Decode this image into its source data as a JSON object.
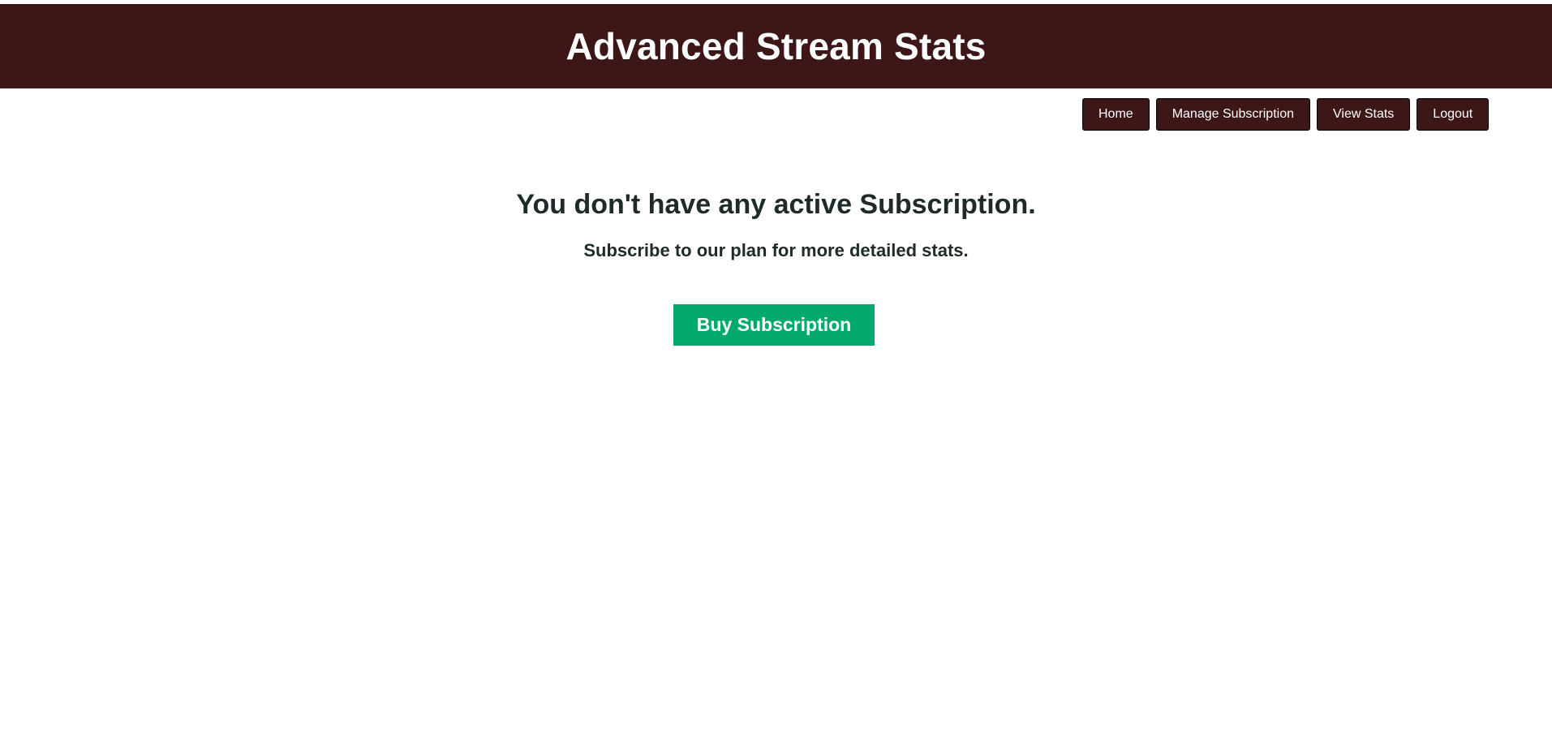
{
  "header": {
    "title": "Advanced Stream Stats"
  },
  "nav": {
    "items": [
      {
        "label": "Home"
      },
      {
        "label": "Manage Subscription"
      },
      {
        "label": "View Stats"
      },
      {
        "label": "Logout"
      }
    ]
  },
  "main": {
    "heading": "You don't have any active Subscription.",
    "subtext": "Subscribe to our plan for more detailed stats.",
    "buy_label": "Buy Subscription"
  },
  "colors": {
    "header_bg": "#3d1717",
    "nav_button_bg": "#3d1717",
    "buy_button_bg": "#04aa6d",
    "text_dark": "#1f2a2a"
  }
}
